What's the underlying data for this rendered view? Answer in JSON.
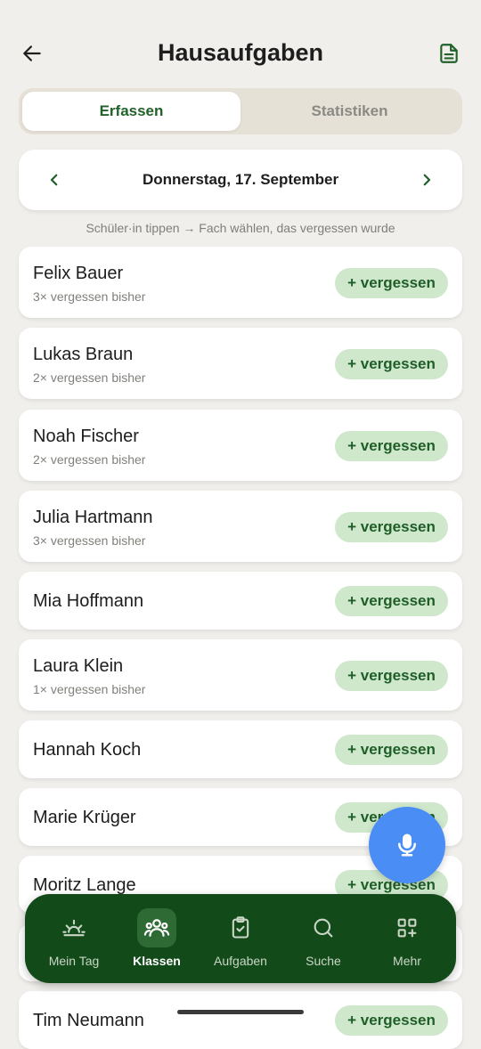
{
  "header": {
    "title": "Hausaufgaben",
    "back_icon": "arrow-left-icon",
    "doc_icon": "document-icon"
  },
  "tabs": [
    {
      "label": "Erfassen",
      "active": true
    },
    {
      "label": "Statistiken",
      "active": false
    }
  ],
  "date_nav": {
    "prev_label": "‹",
    "next_label": "›",
    "date": "Donnerstag, 17. September"
  },
  "hint": "Schüler·in tippen → Fach wählen, das vergessen wurde",
  "students": [
    {
      "name": "Felix Bauer",
      "sub": "3× vergessen bisher",
      "button": "+ vergessen"
    },
    {
      "name": "Lukas Braun",
      "sub": "2× vergessen bisher",
      "button": "+ vergessen"
    },
    {
      "name": "Noah Fischer",
      "sub": "2× vergessen bisher",
      "button": "+ vergessen"
    },
    {
      "name": "Julia Hartmann",
      "sub": "3× vergessen bisher",
      "button": "+ vergessen"
    },
    {
      "name": "Mia Hoffmann",
      "sub": "",
      "button": "+ vergessen"
    },
    {
      "name": "Laura Klein",
      "sub": "1× vergessen bisher",
      "button": "+ vergessen"
    },
    {
      "name": "Hannah Koch",
      "sub": "",
      "button": "+ vergessen"
    },
    {
      "name": "Marie Krüger",
      "sub": "",
      "button": "+ vergessen"
    },
    {
      "name": "Moritz Lange",
      "sub": "",
      "button": "+ vergessen"
    },
    {
      "name": "",
      "sub": "",
      "button": ""
    },
    {
      "name": "Tim Neumann",
      "sub": "",
      "button": "+ vergessen"
    }
  ],
  "fab": {
    "icon": "microphone-icon"
  },
  "nav": [
    {
      "label": "Mein Tag",
      "icon": "sunrise-icon",
      "active": false
    },
    {
      "label": "Klassen",
      "icon": "group-icon",
      "active": true
    },
    {
      "label": "Aufgaben",
      "icon": "clipboard-check-icon",
      "active": false
    },
    {
      "label": "Suche",
      "icon": "search-icon",
      "active": false
    },
    {
      "label": "Mehr",
      "icon": "grid-plus-icon",
      "active": false
    }
  ],
  "colors": {
    "accent_green": "#21612a",
    "nav_background": "#134a1a",
    "button_background": "#cfe8cc",
    "fab_blue": "#4a8ef5",
    "page_background": "#f0efeb"
  }
}
